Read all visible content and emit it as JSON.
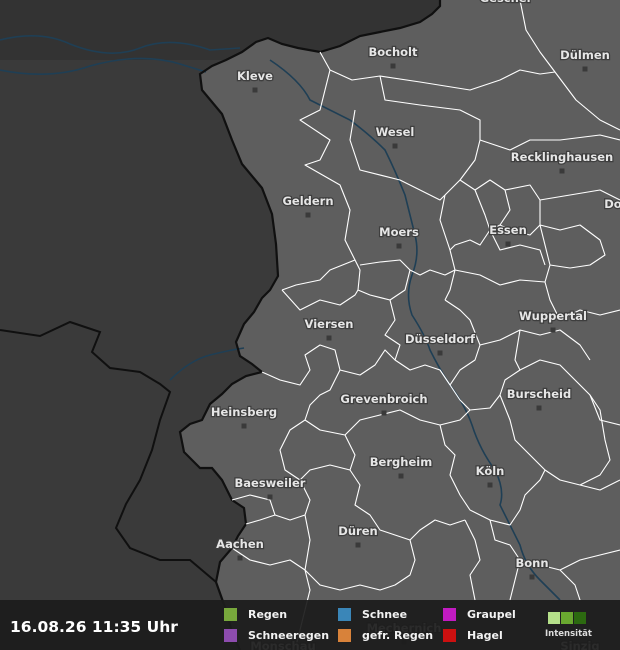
{
  "cities": [
    {
      "name": "Gescher"
    },
    {
      "name": "Bocholt"
    },
    {
      "name": "Dülmen"
    },
    {
      "name": "Kleve"
    },
    {
      "name": "Wesel"
    },
    {
      "name": "Recklinghausen"
    },
    {
      "name": "Do"
    },
    {
      "name": "Geldern"
    },
    {
      "name": "Moers"
    },
    {
      "name": "Essen"
    },
    {
      "name": "Viersen"
    },
    {
      "name": "Düsseldorf"
    },
    {
      "name": "Wuppertal"
    },
    {
      "name": "Grevenbroich"
    },
    {
      "name": "Burscheid"
    },
    {
      "name": "Heinsberg"
    },
    {
      "name": "Bergheim"
    },
    {
      "name": "Köln"
    },
    {
      "name": "Baesweiler"
    },
    {
      "name": "Düren"
    },
    {
      "name": "Aachen"
    },
    {
      "name": "Bonn"
    },
    {
      "name": "Mechernich"
    },
    {
      "name": "Monschau"
    },
    {
      "name": "Sinzig"
    }
  ],
  "footer": {
    "timestamp": "16.08.26 11:35 Uhr",
    "legend": [
      {
        "label": "Regen",
        "color": "#78a83c"
      },
      {
        "label": "Schnee",
        "color": "#3a86b8"
      },
      {
        "label": "Graupel",
        "color": "#c21bc2"
      },
      {
        "label": "Schneeregen",
        "color": "#8d4cae"
      },
      {
        "label": "gefr. Regen",
        "color": "#d8823a"
      },
      {
        "label": "Hagel",
        "color": "#cc1010"
      }
    ],
    "intensity_label": "Intensität",
    "intensity_colors": [
      "#b5e08a",
      "#6aa830",
      "#2c6a10"
    ]
  },
  "colors": {
    "germany_fill": "#5e5e5e",
    "neighbor_fill": "#3a3a3a",
    "border": "#101010",
    "district_line": "#ffffff",
    "water": "#1f3f55"
  }
}
